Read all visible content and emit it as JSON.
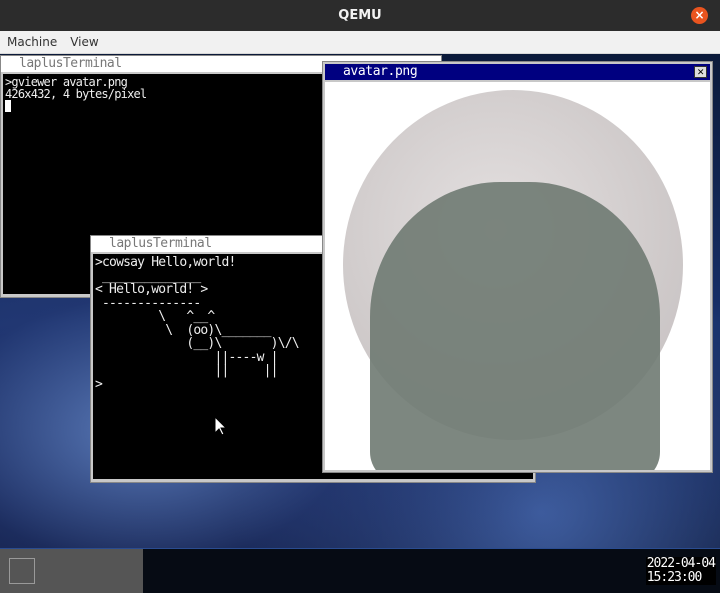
{
  "window": {
    "title": "QEMU",
    "close_icon": "close-icon"
  },
  "menu": [
    "Machine",
    "View"
  ],
  "terminal1": {
    "title": "laplusTerminal",
    "lines": [
      ">gviewer avatar.png",
      "426x432, 4 bytes/pixel"
    ]
  },
  "terminal2": {
    "title": "laplusTerminal",
    "text": ">cowsay Hello,world!\n ______________\n< Hello,world! >\n --------------\n         \\   ^__^\n          \\  (oo)\\_______\n             (__)\\       )\\/\\\n                 ||----w |\n                 ||     ||\n>"
  },
  "viewer": {
    "title": "avatar.png",
    "close_label": "✕"
  },
  "taskbar": {
    "date": "2022-04-04",
    "time": "15:23:00"
  }
}
